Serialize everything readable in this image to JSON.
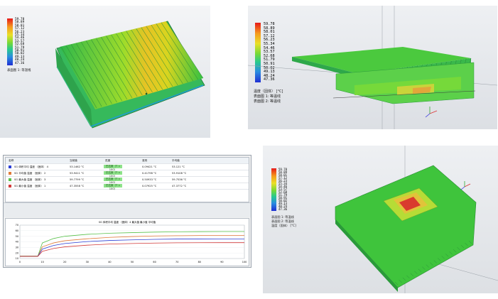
{
  "panels": {
    "p1": {
      "legend": {
        "ticks": [
          "59.78",
          "58.89",
          "58.01",
          "57.12",
          "56.23",
          "55.34",
          "54.46",
          "53.57",
          "52.68",
          "51.79",
          "50.91",
          "50.02",
          "49.13",
          "48.24",
          "47.36"
        ],
        "title": "表面图 1: 等温线"
      }
    },
    "p2": {
      "legend": {
        "ticks": [
          "59.78",
          "58.89",
          "58.01",
          "57.12",
          "56.23",
          "55.34",
          "54.46",
          "53.57",
          "52.68",
          "51.79",
          "50.91",
          "50.02",
          "49.13",
          "48.24",
          "47.36"
        ],
        "title_lines": [
          "温度（固体） [°C]",
          "表面图 1: 等温线",
          "表面图 2: 等温线"
        ]
      }
    },
    "p4": {
      "legend": {
        "ticks": [
          "59.78",
          "58.89",
          "58.01",
          "57.12",
          "56.23",
          "55.34",
          "54.46",
          "53.57",
          "52.68",
          "51.79",
          "50.91",
          "50.02",
          "49.13",
          "48.24",
          "47.36"
        ],
        "title_lines": [
          "表面图 1: 等温线",
          "表面图 2: 等温线",
          "温度（固体） [°C]"
        ]
      }
    },
    "p3": {
      "table": {
        "headers": [
          "名称",
          "当前值",
          "进度",
          "准则",
          "平均值"
        ],
        "rows": [
          {
            "name": "SG 体积平均 温度 （固体） 4",
            "color": "#2c3fd6",
            "current": "53.1462 °C",
            "progress": "已达到（T = 100）",
            "criterion": "0.09421 °C",
            "avg": "53.121 °C"
          },
          {
            "name": "SG 平均值 温度 （固体） 2",
            "color": "#e07b3a",
            "current": "53.9411 °C",
            "progress": "已达到（T = 100）",
            "criterion": "0.41798 °C",
            "avg": "53.9108 °C"
          },
          {
            "name": "SG 最大值 温度 （固体） 3",
            "color": "#58c14a",
            "current": "59.7799 °C",
            "progress": "已达到（T = 100）",
            "criterion": "0.50933 °C",
            "avg": "59.7536 °C"
          },
          {
            "name": "SG 最小值 温度 （固体） 1",
            "color": "#d23a3a",
            "current": "47.3558 °C",
            "progress": "已达到（T = 100）",
            "criterion": "0.07925 °C",
            "avg": "47.3772 °C"
          }
        ]
      },
      "chart_data": {
        "type": "line",
        "title": "SG 体积平均 温度 （固体）4 最大值 最小值 平均值",
        "x": [
          0,
          5,
          8,
          10,
          15,
          20,
          30,
          40,
          50,
          60,
          70,
          80,
          90,
          100
        ],
        "series": [
          {
            "color": "#58c14a",
            "values": [
              14.5,
              14.5,
              14.5,
              38,
              46,
              50,
              53.5,
              55.5,
              56.5,
              57.5,
              58,
              58.3,
              58.5,
              58.5
            ]
          },
          {
            "color": "#e07b3a",
            "values": [
              14.2,
              14.2,
              14.2,
              31,
              38,
              42,
              45.5,
              48,
              49.5,
              50.5,
              51,
              51.3,
              51.5,
              51.5
            ]
          },
          {
            "color": "#2c3fd6",
            "values": [
              14.0,
              14.0,
              14.0,
              27,
              33.5,
              37,
              40.5,
              42.5,
              43.5,
              44.5,
              45,
              45.2,
              45.3,
              45.3
            ]
          },
          {
            "color": "#d23a3a",
            "values": [
              13.8,
              13.8,
              13.8,
              23,
              28,
              31,
              34,
              36,
              37,
              37.8,
              38.2,
              38.4,
              38.5,
              38.5
            ]
          }
        ],
        "ylim": [
          10,
          70
        ],
        "xlim": [
          0,
          100
        ],
        "yticks": [
          "70",
          "60",
          "50",
          "40",
          "30",
          "20",
          "10"
        ],
        "xticks": [
          "0",
          "10",
          "20",
          "30",
          "40",
          "50",
          "60",
          "70",
          "80",
          "90",
          "100"
        ]
      }
    }
  }
}
